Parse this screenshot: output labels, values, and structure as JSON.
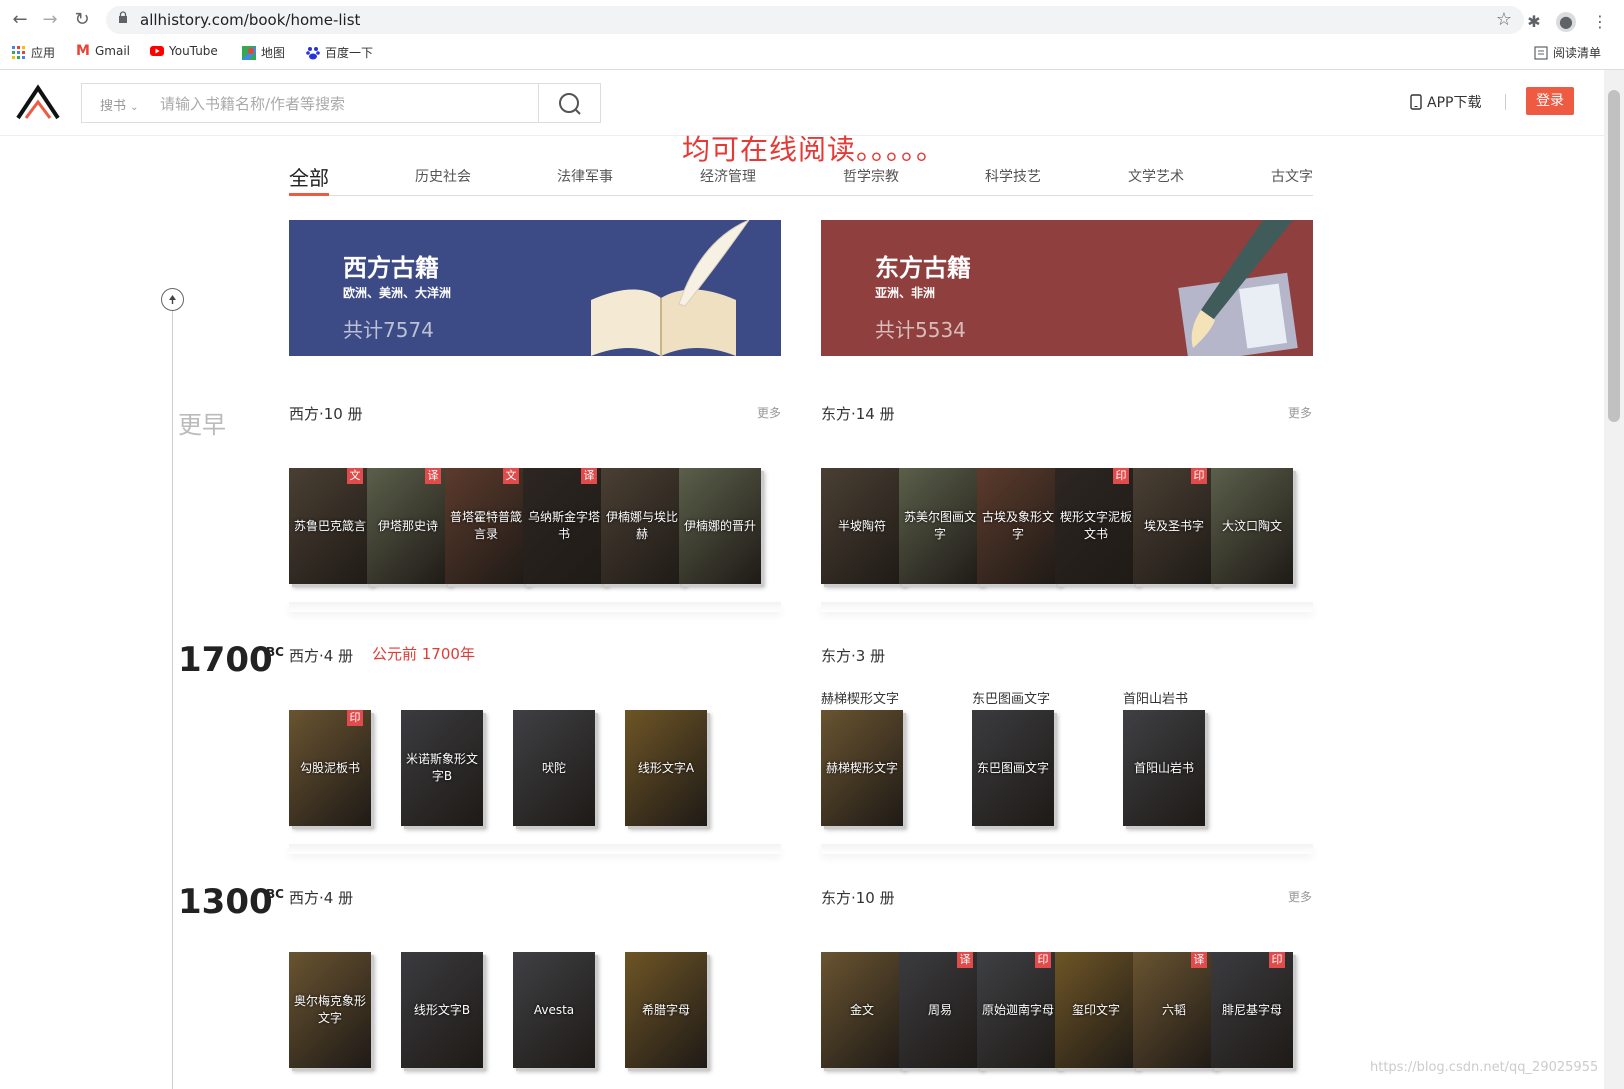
{
  "browser": {
    "url": "allhistory.com/book/home-list",
    "bookmarks": [
      "应用",
      "Gmail",
      "YouTube",
      "地图",
      "百度一下"
    ],
    "reading_list": "阅读清单"
  },
  "header": {
    "search_category": "搜书",
    "search_placeholder": "请输入书籍名称/作者等搜索",
    "app_download": "APP下载",
    "login": "登录",
    "accent": "#ef5a43"
  },
  "annotation": "均可在线阅读。。。。。",
  "tabs": [
    "全部",
    "历史社会",
    "法律军事",
    "经济管理",
    "哲学宗教",
    "科学技艺",
    "文学艺术",
    "古文字"
  ],
  "banners": {
    "west": {
      "title": "西方古籍",
      "subtitle": "欧洲、美洲、大洋洲",
      "count": "共计7574",
      "color": "#3c4a86"
    },
    "east": {
      "title": "东方古籍",
      "subtitle": "亚洲、非洲",
      "count": "共计5534",
      "color": "#8f3f3d"
    }
  },
  "timeline": {
    "earlier": "更早",
    "eras": [
      {
        "year": "1700",
        "bc": "BC"
      },
      {
        "year": "1300",
        "bc": "BC"
      }
    ]
  },
  "sections": {
    "earlier_west": {
      "label": "西方·10 册",
      "more": "更多"
    },
    "earlier_east": {
      "label": "东方·14 册",
      "more": "更多"
    },
    "e1700_west": {
      "label": "西方·4 册",
      "note": "公元前 1700年"
    },
    "e1700_east": {
      "label": "东方·3 册"
    },
    "e1300_west": {
      "label": "西方·4 册"
    },
    "e1300_east": {
      "label": "东方·10 册",
      "more": "更多"
    }
  },
  "books": {
    "earlier_west": [
      {
        "title": "苏鲁巴克箴言",
        "badge": "文"
      },
      {
        "title": "伊塔那史诗",
        "badge": "译"
      },
      {
        "title": "普塔霍特普箴言录",
        "badge": "文"
      },
      {
        "title": "乌纳斯金字塔书",
        "badge": "译"
      },
      {
        "title": "伊楠娜与埃比赫",
        "badge": ""
      },
      {
        "title": "伊楠娜的晋升",
        "badge": ""
      }
    ],
    "earlier_east": [
      {
        "title": "半坡陶符",
        "badge": ""
      },
      {
        "title": "苏美尔图画文字",
        "badge": ""
      },
      {
        "title": "古埃及象形文字",
        "badge": ""
      },
      {
        "title": "楔形文字泥板文书",
        "badge": "印"
      },
      {
        "title": "埃及圣书字",
        "badge": "印"
      },
      {
        "title": "大汶口陶文",
        "badge": ""
      }
    ],
    "e1700_west": [
      {
        "title": "勾股泥板书",
        "badge": "印"
      },
      {
        "title": "米诺斯象形文字B",
        "badge": ""
      },
      {
        "title": "吠陀",
        "badge": ""
      },
      {
        "title": "线形文字A",
        "badge": ""
      }
    ],
    "e1700_east": [
      {
        "title": "赫梯楔形文字",
        "caption": "赫梯楔形文字"
      },
      {
        "title": "东巴图画文字",
        "caption": "东巴图画文字"
      },
      {
        "title": "首阳山岩书",
        "caption": "首阳山岩书"
      }
    ],
    "e1300_west": [
      {
        "title": "奥尔梅克象形文字",
        "badge": ""
      },
      {
        "title": "线形文字B",
        "badge": ""
      },
      {
        "title": "Avesta",
        "badge": ""
      },
      {
        "title": "希腊字母",
        "badge": ""
      }
    ],
    "e1300_east": [
      {
        "title": "金文",
        "badge": ""
      },
      {
        "title": "周易",
        "badge": "译"
      },
      {
        "title": "原始迦南字母",
        "badge": "印"
      },
      {
        "title": "玺印文字",
        "badge": ""
      },
      {
        "title": "六韬",
        "badge": "译"
      },
      {
        "title": "腓尼基字母",
        "badge": "印"
      }
    ]
  },
  "watermark": "https://blog.csdn.net/qq_29025955"
}
